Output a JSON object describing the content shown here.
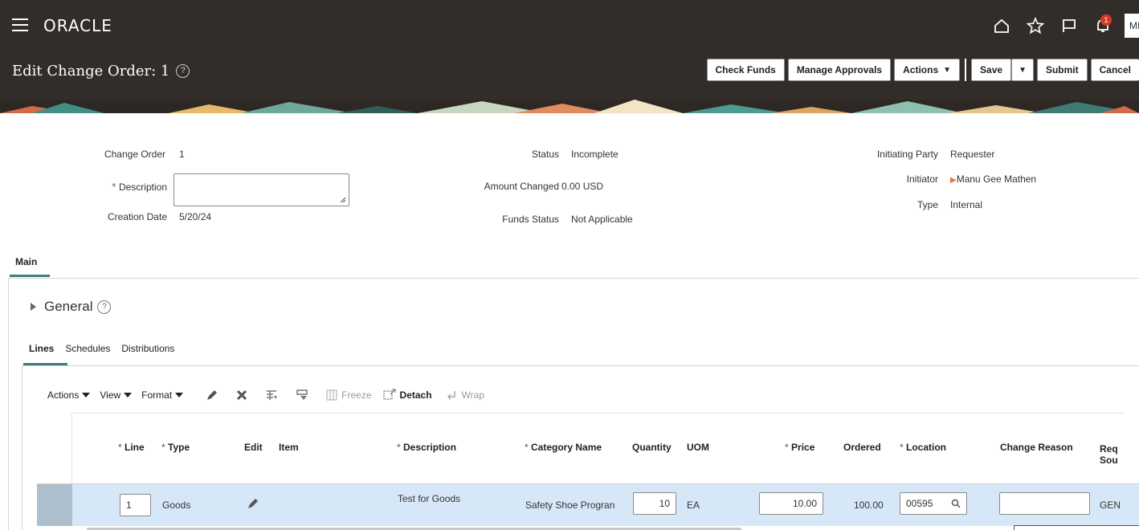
{
  "brand": "ORACLE",
  "user_initials": "MI",
  "notification_count": "1",
  "page": {
    "title": "Edit Change Order: 1",
    "help": "?"
  },
  "buttons": {
    "check_funds": "Check Funds",
    "manage_approvals": "Manage Approvals",
    "actions": "Actions",
    "save": "Save",
    "submit": "Submit",
    "cancel": "Cancel"
  },
  "header_fields": {
    "change_order_label": "Change Order",
    "change_order_value": "1",
    "description_label": "Description",
    "description_value": "",
    "creation_date_label": "Creation Date",
    "creation_date_value": "5/20/24",
    "status_label": "Status",
    "status_value": "Incomplete",
    "amount_changed_label": "Amount Changed",
    "amount_changed_value": "0.00 USD",
    "funds_status_label": "Funds Status",
    "funds_status_value": "Not Applicable",
    "initiating_party_label": "Initiating Party",
    "initiating_party_value": "Requester",
    "initiator_label": "Initiator",
    "initiator_value": "Manu Gee Mathen",
    "type_label": "Type",
    "type_value": "Internal"
  },
  "tabs": {
    "main": "Main"
  },
  "general_section": "General",
  "subtabs": [
    "Lines",
    "Schedules",
    "Distributions"
  ],
  "toolbar": {
    "actions": "Actions",
    "view": "View",
    "format": "Format",
    "freeze": "Freeze",
    "detach": "Detach",
    "wrap": "Wrap"
  },
  "table": {
    "columns": {
      "line": "Line",
      "type": "Type",
      "edit": "Edit",
      "item": "Item",
      "description": "Description",
      "category_name": "Category Name",
      "quantity": "Quantity",
      "uom": "UOM",
      "price": "Price",
      "ordered": "Ordered",
      "location": "Location",
      "change_reason": "Change Reason",
      "req_source_1": "Req",
      "req_source_2": "Sou"
    },
    "rows": [
      {
        "line": "1",
        "type": "Goods",
        "item": "",
        "description": "Test for Goods",
        "category_name": "Safety Shoe Progran",
        "quantity": "10",
        "uom": "EA",
        "price": "10.00",
        "ordered": "100.00",
        "location": "00595",
        "change_reason": "",
        "req_source": "GEN"
      }
    ]
  },
  "colors": {
    "header_bg": "#332d29",
    "tab_accent": "#3b7e7b",
    "row_selected": "#d6e8f7",
    "row_marker": "#adbfcd"
  }
}
